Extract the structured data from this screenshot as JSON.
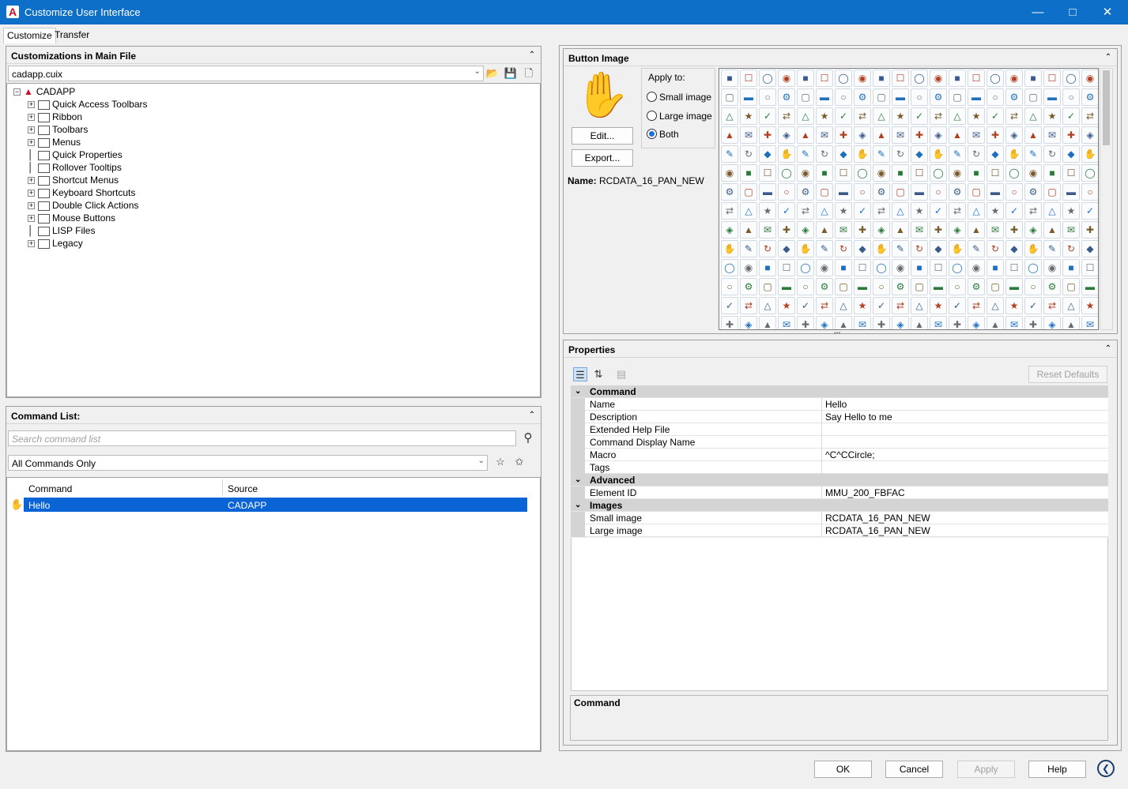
{
  "window": {
    "title": "Customize User Interface"
  },
  "tabs": [
    "Customize",
    "Transfer"
  ],
  "customizations": {
    "header": "Customizations in Main File",
    "file": "cadapp.cuix",
    "root": "CADAPP",
    "items": [
      "Quick Access Toolbars",
      "Ribbon",
      "Toolbars",
      "Menus",
      "Quick Properties",
      "Rollover Tooltips",
      "Shortcut Menus",
      "Keyboard Shortcuts",
      "Double Click Actions",
      "Mouse Buttons",
      "LISP Files",
      "Legacy"
    ]
  },
  "command_list": {
    "header": "Command List:",
    "search_placeholder": "Search command list",
    "filter": "All Commands Only",
    "columns": [
      "Command",
      "Source"
    ],
    "rows": [
      {
        "command": "Hello",
        "source": "CADAPP"
      }
    ]
  },
  "button_image": {
    "header": "Button Image",
    "apply_to": "Apply to:",
    "options": [
      "Small image",
      "Large image",
      "Both"
    ],
    "selected": "Both",
    "edit": "Edit...",
    "export": "Export...",
    "name_label": "Name:",
    "name_value": "RCDATA_16_PAN_NEW"
  },
  "properties": {
    "header": "Properties",
    "reset": "Reset Defaults",
    "categories": [
      {
        "title": "Command",
        "rows": [
          [
            "Name",
            "Hello"
          ],
          [
            "Description",
            "Say Hello to me"
          ],
          [
            "Extended Help File",
            ""
          ],
          [
            "Command Display Name",
            ""
          ],
          [
            "Macro",
            "^C^CCircle;"
          ],
          [
            "Tags",
            ""
          ]
        ]
      },
      {
        "title": "Advanced",
        "rows": [
          [
            "Element ID",
            "MMU_200_FBFAC"
          ]
        ]
      },
      {
        "title": "Images",
        "rows": [
          [
            "Small image",
            "RCDATA_16_PAN_NEW"
          ],
          [
            "Large image",
            "RCDATA_16_PAN_NEW"
          ]
        ]
      }
    ],
    "description_title": "Command"
  },
  "footer": {
    "ok": "OK",
    "cancel": "Cancel",
    "apply": "Apply",
    "help": "Help"
  },
  "colors": {
    "titlebar": "#0d6fc7",
    "selection": "#0a64d6",
    "accent": "#c8102e"
  }
}
